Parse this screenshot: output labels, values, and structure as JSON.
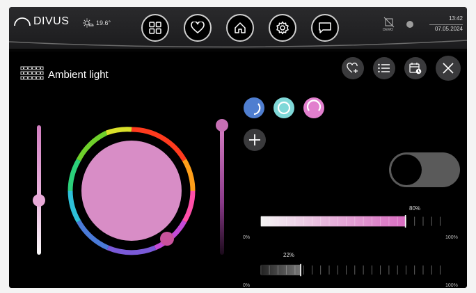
{
  "header": {
    "brand": "DIVUS",
    "temperature": "19.6°",
    "nav": [
      {
        "name": "apps",
        "icon": "grid-icon"
      },
      {
        "name": "favorites",
        "icon": "heart-icon"
      },
      {
        "name": "home",
        "icon": "house-icon"
      },
      {
        "name": "settings",
        "icon": "gear-icon"
      },
      {
        "name": "messages",
        "icon": "chat-icon"
      }
    ],
    "demo_label": "DEMO",
    "time": "13:42",
    "date": "07.05.2024"
  },
  "device": {
    "title": "Ambient light",
    "icon": "led-strip-icon",
    "toolbar": [
      "heart-plus-icon",
      "list-icon",
      "schedule-icon",
      "close-icon"
    ],
    "presets": [
      {
        "color": "#4f7ed0"
      },
      {
        "color": "#7fd8d8"
      },
      {
        "color": "#e27fce"
      }
    ],
    "current_color": "#d88dc6",
    "power_on": false,
    "slider_level": 0.42,
    "saturation_level": 1.0,
    "bar1": {
      "value": 80,
      "label": "80%",
      "min": "0%",
      "max": "100%"
    },
    "bar2": {
      "value": 22,
      "label": "22%",
      "min": "0%",
      "max": "100%"
    }
  }
}
